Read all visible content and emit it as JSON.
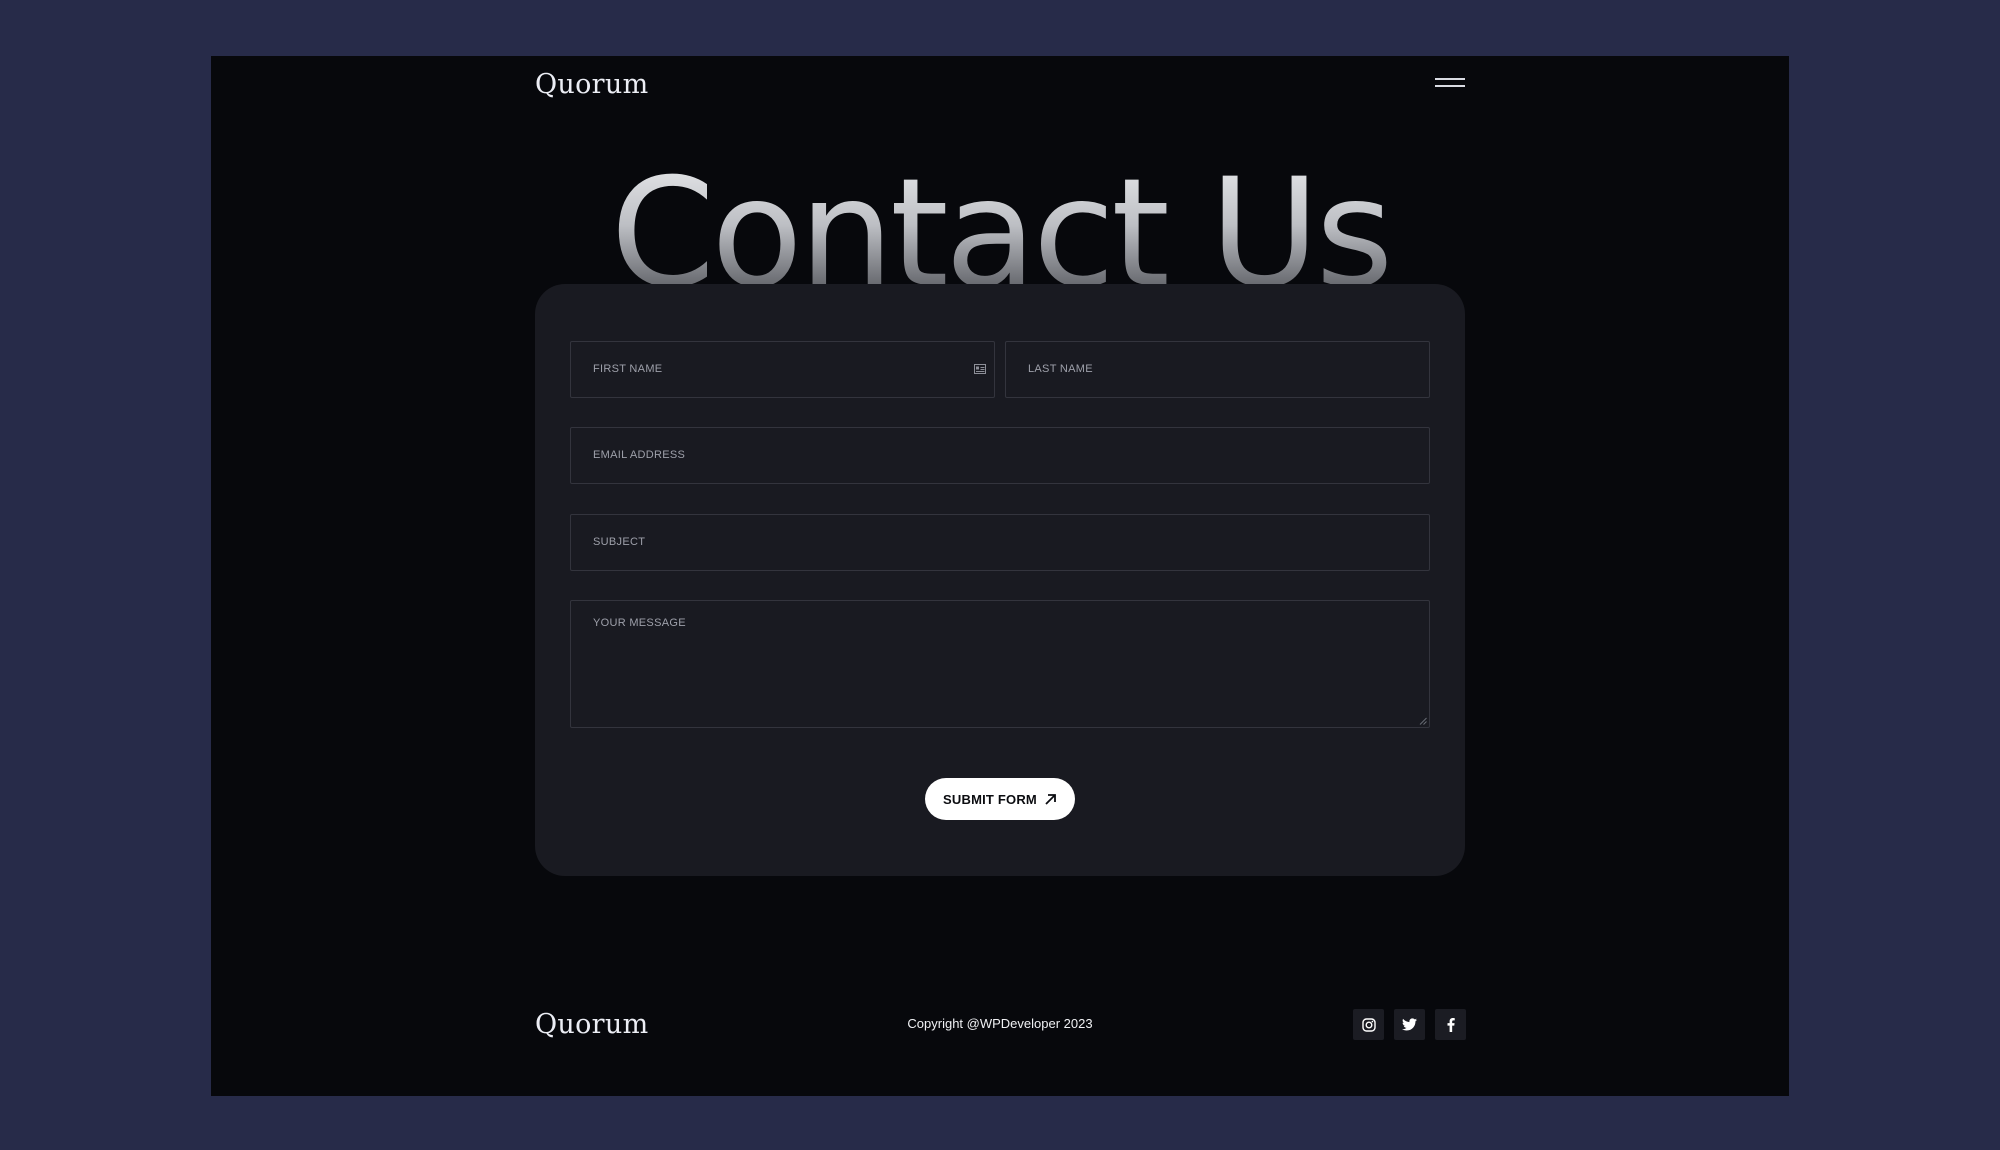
{
  "header": {
    "logo": "Quorum",
    "menu_icon": "hamburger-menu-icon"
  },
  "hero": {
    "title": "Contact Us"
  },
  "form": {
    "first_name_placeholder": "FIRST NAME",
    "last_name_placeholder": "LAST NAME",
    "email_placeholder": "EMAIL ADDRESS",
    "subject_placeholder": "SUBJECT",
    "message_placeholder": "YOUR MESSAGE",
    "submit_label": "SUBMIT FORM",
    "submit_icon": "arrow-up-right-icon",
    "autofill_icon": "contact-card-icon"
  },
  "footer": {
    "logo": "Quorum",
    "copyright": "Copyright @WPDeveloper 2023",
    "social": [
      {
        "name": "instagram",
        "icon": "instagram-icon"
      },
      {
        "name": "twitter",
        "icon": "twitter-icon"
      },
      {
        "name": "facebook",
        "icon": "facebook-icon"
      }
    ]
  },
  "colors": {
    "outer_background": "#272b49",
    "page_background": "#07080c",
    "card_background": "#191a21",
    "field_border": "#33343d",
    "button_background": "#ffffff"
  }
}
